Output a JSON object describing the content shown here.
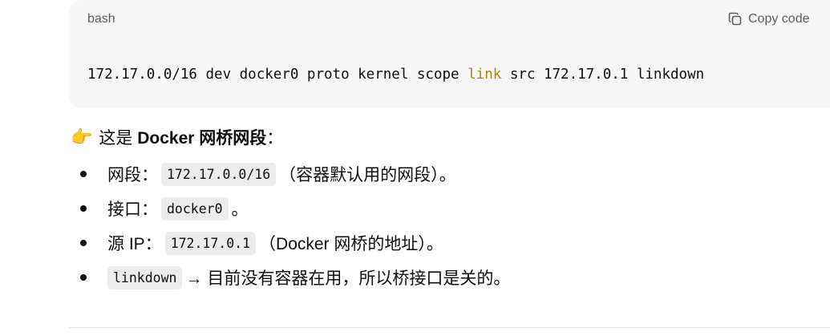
{
  "code_block": {
    "language": "bash",
    "copy_label": "Copy code",
    "line_parts": [
      "172.17.0.0/16 dev docker0 proto kernel scope ",
      "link",
      " src 172.17.0.1 linkdown"
    ]
  },
  "section": {
    "emoji": "👉",
    "heading_prefix": "这是 ",
    "heading_bold": "Docker 网桥网段",
    "heading_suffix": "："
  },
  "items": [
    {
      "label": "网段：",
      "code": "172.17.0.0/16",
      "text": "（容器默认用的网段）。"
    },
    {
      "label": "接口：",
      "code": "docker0",
      "text": "。"
    },
    {
      "label": "源 IP：",
      "code": "172.17.0.1",
      "text": "（Docker 网桥的地址）。"
    },
    {
      "label": "",
      "code": "linkdown",
      "text": "→ 目前没有容器在用，所以桥接口是关的。"
    }
  ],
  "colors": {
    "keyword": "#b0840c",
    "code_bg": "#f7f7f8",
    "inline_code_bg": "#ececec"
  }
}
